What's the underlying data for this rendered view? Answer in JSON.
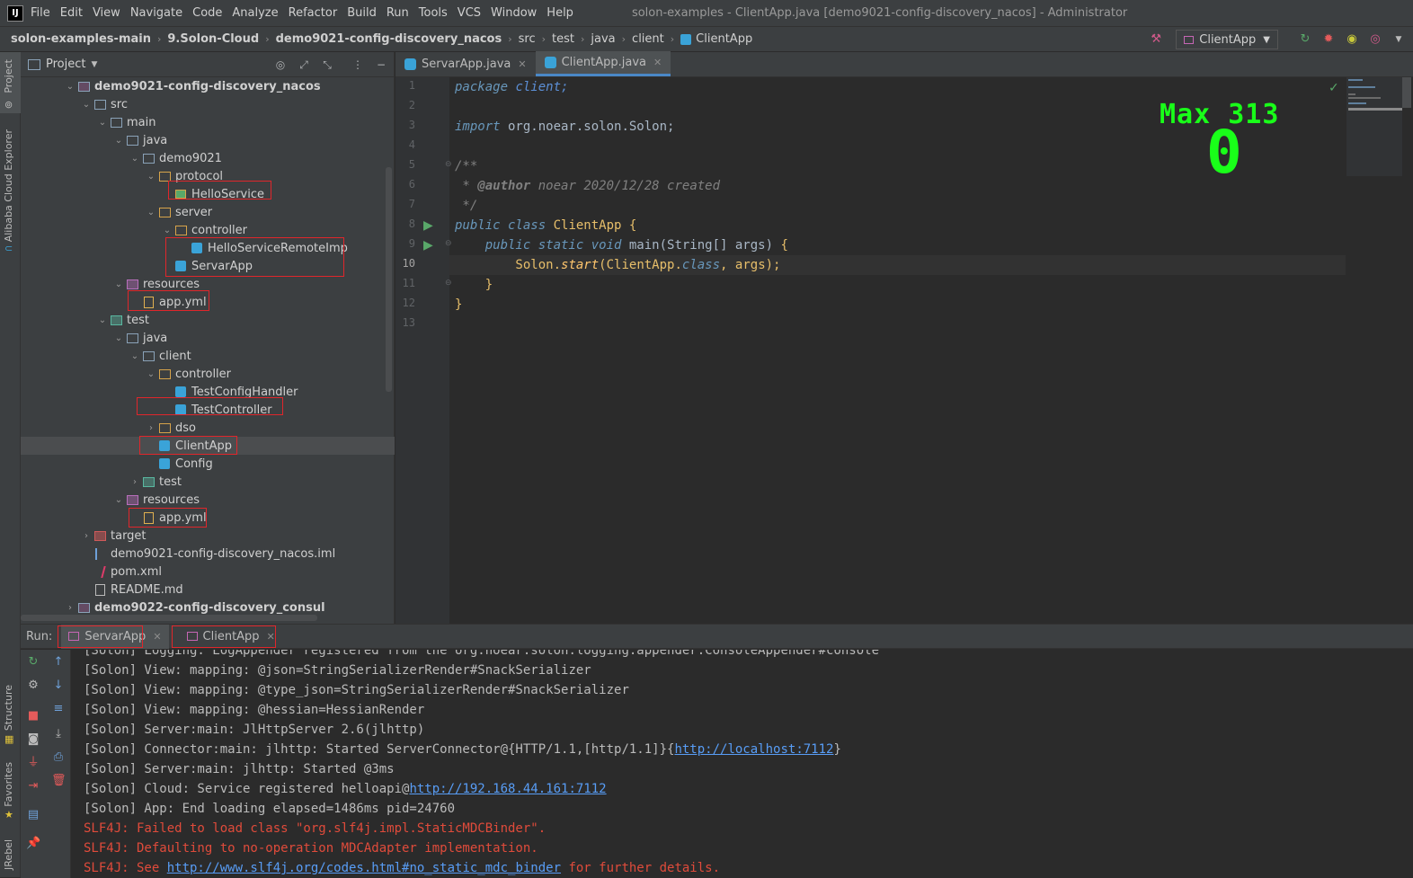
{
  "menubar": {
    "logo": "IJ",
    "items": [
      "File",
      "Edit",
      "View",
      "Navigate",
      "Code",
      "Analyze",
      "Refactor",
      "Build",
      "Run",
      "Tools",
      "VCS",
      "Window",
      "Help"
    ],
    "window_title": "solon-examples - ClientApp.java [demo9021-config-discovery_nacos] - Administrator"
  },
  "breadcrumb": {
    "items": [
      "solon-examples-main",
      "9.Solon-Cloud",
      "demo9021-config-discovery_nacos",
      "src",
      "test",
      "java",
      "client",
      "ClientApp"
    ],
    "run_config": "ClientApp"
  },
  "left_strip": {
    "project": "Project",
    "cloud": "Alibaba Cloud Explorer",
    "structure": "Structure",
    "favorites": "Favorites",
    "jrebel": "JRebel"
  },
  "project_panel": {
    "title": "Project",
    "tree": [
      {
        "label": "demo9021-config-discovery_nacos",
        "bold": true,
        "icon": "module-folder-icon"
      },
      {
        "label": "src",
        "icon": "folder-icon"
      },
      {
        "label": "main",
        "icon": "folder-icon"
      },
      {
        "label": "java",
        "icon": "folder-icon"
      },
      {
        "label": "demo9021",
        "icon": "folder-icon"
      },
      {
        "label": "protocol",
        "icon": "package-icon"
      },
      {
        "label": "HelloService",
        "icon": "interface-icon"
      },
      {
        "label": "server",
        "icon": "package-icon"
      },
      {
        "label": "controller",
        "icon": "package-icon"
      },
      {
        "label": "HelloServiceRemoteImp",
        "icon": "class-icon"
      },
      {
        "label": "ServarApp",
        "icon": "class-icon"
      },
      {
        "label": "resources",
        "icon": "resources-folder-icon"
      },
      {
        "label": "app.yml",
        "icon": "yaml-icon"
      },
      {
        "label": "test",
        "icon": "test-folder-icon"
      },
      {
        "label": "java",
        "icon": "folder-icon"
      },
      {
        "label": "client",
        "icon": "folder-icon"
      },
      {
        "label": "controller",
        "icon": "package-icon"
      },
      {
        "label": "TestConfigHandler",
        "icon": "class-icon"
      },
      {
        "label": "TestController",
        "icon": "class-icon"
      },
      {
        "label": "dso",
        "icon": "package-icon"
      },
      {
        "label": "ClientApp",
        "icon": "class-icon"
      },
      {
        "label": "Config",
        "icon": "class-icon"
      },
      {
        "label": "test",
        "icon": "test-folder-icon"
      },
      {
        "label": "resources",
        "icon": "resources-folder-icon"
      },
      {
        "label": "app.yml",
        "icon": "yaml-icon"
      },
      {
        "label": "target",
        "icon": "excluded-folder-icon"
      },
      {
        "label": "demo9021-config-discovery_nacos.iml",
        "icon": "iml-icon"
      },
      {
        "label": "pom.xml",
        "icon": "maven-icon"
      },
      {
        "label": "README.md",
        "icon": "markdown-icon"
      },
      {
        "label": "demo9022-config-discovery_consul",
        "bold": true,
        "icon": "module-folder-icon"
      }
    ]
  },
  "editor": {
    "tabs": [
      {
        "label": "ServarApp.java",
        "active": false
      },
      {
        "label": "ClientApp.java",
        "active": true
      }
    ],
    "line_numbers": [
      "1",
      "2",
      "3",
      "4",
      "5",
      "6",
      "7",
      "8",
      "9",
      "10",
      "11",
      "12",
      "13"
    ],
    "current_line": "10",
    "code": {
      "l1_kw": "package",
      "l1_rest": " client;",
      "l3_kw": "import",
      "l3_rest": " org.noear.solon.Solon;",
      "l5": "/**",
      "l6_a": " * ",
      "l6_tag": "@author",
      "l6_b": " noear 2020/12/28 created",
      "l7": " */",
      "l8_kw": "public class",
      "l8_name": " ClientApp",
      "l8_brace": " {",
      "l9_kw": "    public static void",
      "l9_fn": " main",
      "l9_args": "(String[] args)",
      "l9_brace": " {",
      "l10_cls": "        Solon.",
      "l10_fn": "start",
      "l10_a": "(ClientApp.",
      "l10_kw": "class",
      "l10_b": ", args);",
      "l11": "    }",
      "l12": "}"
    }
  },
  "overlay": {
    "max_label": "Max 313",
    "score": "0"
  },
  "run_panel": {
    "label": "Run:",
    "tabs": [
      {
        "label": "ServarApp",
        "active": true
      },
      {
        "label": "ClientApp",
        "active": false
      }
    ],
    "console": [
      {
        "text": "[Solon] Logging: LogAppender registered from the org.noear.solon.logging.appender.ConsoleAppender#console"
      },
      {
        "text": "[Solon] View: mapping: @json=StringSerializerRender#SnackSerializer"
      },
      {
        "text": "[Solon] View: mapping: @type_json=StringSerializerRender#SnackSerializer"
      },
      {
        "text": "[Solon] View: mapping: @hessian=HessianRender"
      },
      {
        "text": "[Solon] Server:main: JlHttpServer 2.6(jlhttp)"
      },
      {
        "pre": "[Solon] Connector:main: jlhttp: Started ServerConnector@{HTTP/1.1,[http/1.1]}{",
        "link": "http://localhost:7112",
        "post": "}"
      },
      {
        "text": "[Solon] Server:main: jlhttp: Started @3ms"
      },
      {
        "pre": "[Solon] Cloud: Service registered helloapi@",
        "link": "http://192.168.44.161:7112",
        "post": ""
      },
      {
        "text": "[Solon] App: End loading elapsed=1486ms pid=24760"
      },
      {
        "text": "SLF4J: Failed to load class \"org.slf4j.impl.StaticMDCBinder\".",
        "err": true
      },
      {
        "text": "SLF4J: Defaulting to no-operation MDCAdapter implementation.",
        "err": true
      },
      {
        "pre": "SLF4J: See ",
        "link": "http://www.slf4j.org/codes.html#no_static_mdc_binder",
        "post": " for further details.",
        "err": true
      }
    ]
  }
}
